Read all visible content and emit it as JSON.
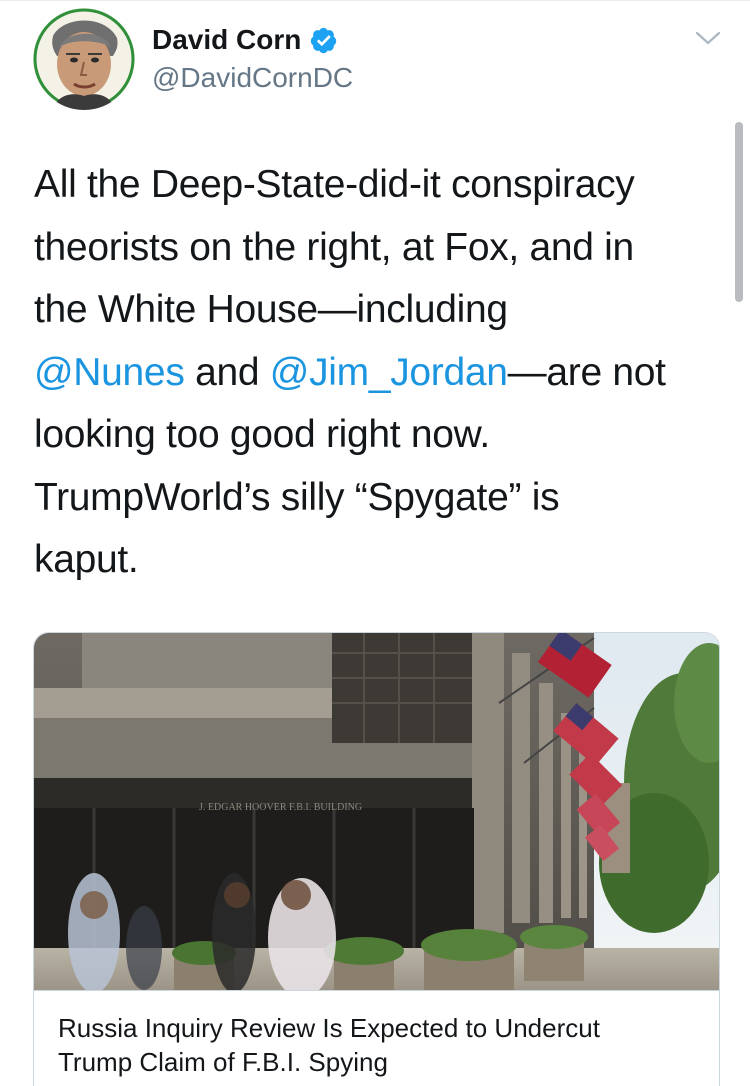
{
  "tweet": {
    "author": {
      "display_name": "David Corn",
      "handle": "@DavidCornDC",
      "verified": true
    },
    "text_lines": [
      [
        "All the Deep-State-did-it conspiracy"
      ],
      [
        "theorists on the right, at Fox, and in"
      ],
      [
        "the White House—including"
      ],
      [
        "@Nunes",
        " and ",
        "@Jim_Jordan",
        "—are not"
      ],
      [
        "looking too good right now."
      ],
      [
        "TrumpWorld’s silly “Spygate” is"
      ],
      [
        "kaput."
      ]
    ],
    "mentions": {
      "first": "@Nunes",
      "second": "@Jim_Jordan"
    }
  },
  "card": {
    "image_sign": "J. EDGAR HOOVER F.B.I. BUILDING",
    "title_lines": [
      "Russia Inquiry Review Is Expected to Undercut",
      "Trump Claim of F.B.I. Spying"
    ]
  },
  "icons": {
    "verified": "verified-badge-icon",
    "caret": "chevron-down-icon"
  },
  "colors": {
    "link": "#1b95e0",
    "verified": "#1da1f2",
    "muted": "#657786",
    "text": "#14171a"
  }
}
